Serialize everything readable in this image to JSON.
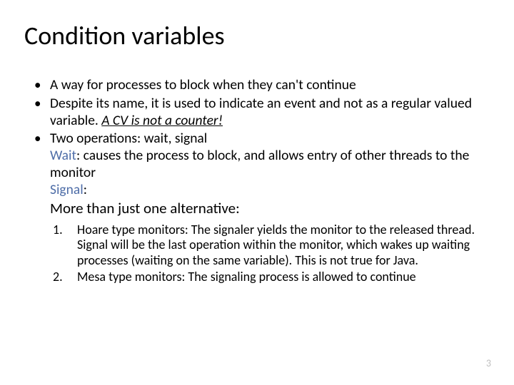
{
  "title": "Condition variables",
  "bullets": {
    "b1": "A way for processes to block when they can't continue",
    "b2a": "Despite its name, it is used to indicate an event and not as a regular valued variable. ",
    "b2b": "A CV is not a counter!",
    "b3a": "Two operations: wait, signal",
    "waitTerm": "Wait",
    "waitText": ": causes the process to block, and allows entry of other threads to the monitor",
    "signalTerm": "Signal",
    "signalColon": ":",
    "more": "More than just one alternative:"
  },
  "numlist": {
    "n1": "1.",
    "n1a": "Hoare type monitors: The signaler yields the monitor to the released thread. Signal will be the last operation within the monitor, which wakes up waiting processes (waiting on the same variable). This is ",
    "n1b": "not true for Java",
    "n1c": ".",
    "n2": "2.",
    "n2a": "Mesa type monitors: The signaling process is allowed to continue"
  },
  "pageNumber": "3"
}
